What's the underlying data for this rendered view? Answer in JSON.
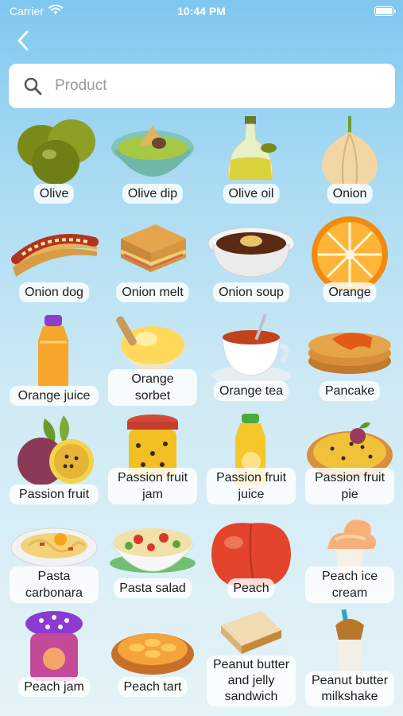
{
  "status": {
    "carrier": "Carrier",
    "time": "10:44 PM"
  },
  "search": {
    "placeholder": "Product",
    "value": ""
  },
  "products": [
    {
      "label": "Olive",
      "icon": "olive-icon"
    },
    {
      "label": "Olive dip",
      "icon": "olive-dip-icon"
    },
    {
      "label": "Olive oil",
      "icon": "olive-oil-icon"
    },
    {
      "label": "Onion",
      "icon": "onion-icon"
    },
    {
      "label": "Onion dog",
      "icon": "onion-dog-icon"
    },
    {
      "label": "Onion melt",
      "icon": "onion-melt-icon"
    },
    {
      "label": "Onion soup",
      "icon": "onion-soup-icon"
    },
    {
      "label": "Orange",
      "icon": "orange-icon"
    },
    {
      "label": "Orange juice",
      "icon": "orange-juice-icon"
    },
    {
      "label": "Orange sorbet",
      "icon": "orange-sorbet-icon"
    },
    {
      "label": "Orange tea",
      "icon": "orange-tea-icon"
    },
    {
      "label": "Pancake",
      "icon": "pancake-icon"
    },
    {
      "label": "Passion fruit",
      "icon": "passion-fruit-icon"
    },
    {
      "label": "Passion fruit jam",
      "icon": "passion-fruit-jam-icon"
    },
    {
      "label": "Passion fruit juice",
      "icon": "passion-fruit-juice-icon"
    },
    {
      "label": "Passion fruit pie",
      "icon": "passion-fruit-pie-icon"
    },
    {
      "label": "Pasta carbonara",
      "icon": "pasta-carbonara-icon"
    },
    {
      "label": "Pasta salad",
      "icon": "pasta-salad-icon"
    },
    {
      "label": "Peach",
      "icon": "peach-icon"
    },
    {
      "label": "Peach ice cream",
      "icon": "peach-ice-cream-icon"
    },
    {
      "label": "Peach jam",
      "icon": "peach-jam-icon"
    },
    {
      "label": "Peach tart",
      "icon": "peach-tart-icon"
    },
    {
      "label": "Peanut butter and jelly sandwich",
      "icon": "peanut-butter-jelly-sandwich-icon"
    },
    {
      "label": "Peanut butter milkshake",
      "icon": "peanut-butter-milkshake-icon"
    }
  ]
}
